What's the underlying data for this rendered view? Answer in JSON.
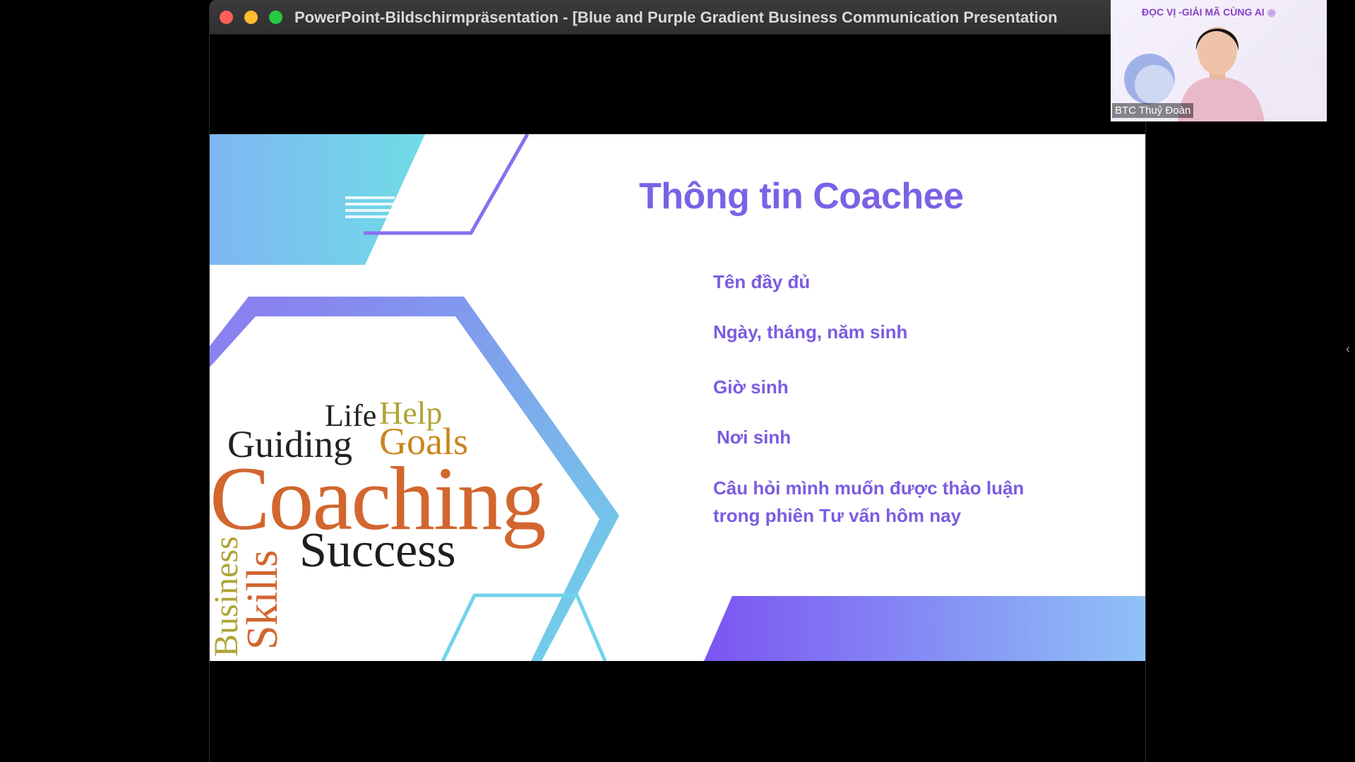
{
  "window": {
    "title": "PowerPoint-Bildschirmpräsentation - [Blue and Purple Gradient Business Communication Presentation"
  },
  "slide": {
    "title": "Thông tin Coachee",
    "items": [
      "Tên  đầy đủ",
      "Ngày, tháng, năm sinh",
      "Giờ sinh",
      "Nơi sinh",
      "Câu hỏi mình muốn được thảo luận trong phiên Tư vấn hôm nay"
    ],
    "word_cloud": {
      "life": "Life",
      "help": "Help",
      "guiding": "Guiding",
      "goals": "Goals",
      "coaching": "Coaching",
      "success": "Success",
      "skills": "Skills",
      "business": "Business"
    }
  },
  "webcam": {
    "banner": "ĐỌC VỊ -GIẢI MÃ CÙNG AI",
    "participant": "BTC Thuỷ Đoàn"
  },
  "side_toggle": "‹",
  "colors": {
    "accent_purple": "#7b62e6",
    "coaching_orange": "#d2662e",
    "gradient_cyan": "#6fd8e6",
    "gradient_blue": "#8ab8f8"
  },
  "icons": [
    "close-dot",
    "minimize-dot",
    "maximize-dot",
    "chevron-left-icon",
    "location-pin-icon"
  ]
}
